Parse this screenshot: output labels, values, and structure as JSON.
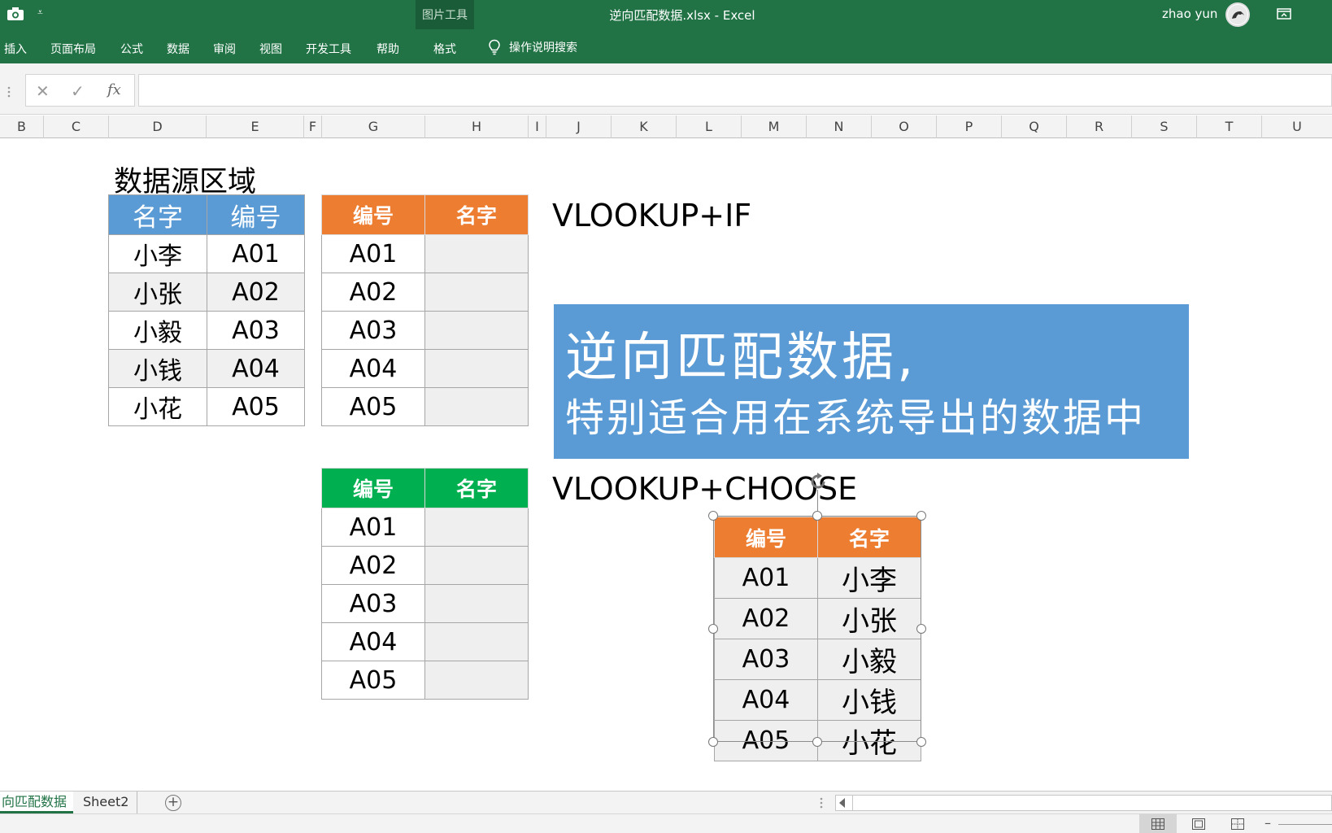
{
  "titlebar": {
    "window_title": "逆向匹配数据.xlsx  -  Excel",
    "context_group": "图片工具",
    "user_name": "zhao yun",
    "qat_more": "⩡"
  },
  "ribbon": {
    "tabs": [
      {
        "label": "插入"
      },
      {
        "label": "页面布局"
      },
      {
        "label": "公式"
      },
      {
        "label": "数据"
      },
      {
        "label": "审阅"
      },
      {
        "label": "视图"
      },
      {
        "label": "开发工具"
      },
      {
        "label": "帮助"
      }
    ],
    "active_tab": "格式",
    "tell_me": "操作说明搜索"
  },
  "formula_bar": {
    "cancel": "✕",
    "enter": "✓",
    "fx": "fx",
    "value": ""
  },
  "columns": [
    "B",
    "C",
    "D",
    "E",
    "F",
    "G",
    "H",
    "I",
    "J",
    "K",
    "L",
    "M",
    "N",
    "O",
    "P",
    "Q",
    "R",
    "S",
    "T",
    "U"
  ],
  "sheet": {
    "source_title": "数据源区域",
    "source_table": {
      "headers": [
        "名字",
        "编号"
      ],
      "rows": [
        [
          "小李",
          "A01"
        ],
        [
          "小张",
          "A02"
        ],
        [
          "小毅",
          "A03"
        ],
        [
          "小钱",
          "A04"
        ],
        [
          "小花",
          "A05"
        ]
      ]
    },
    "if_label": "VLOOKUP+IF",
    "if_table": {
      "headers": [
        "编号",
        "名字"
      ],
      "rows": [
        [
          "A01",
          ""
        ],
        [
          "A02",
          ""
        ],
        [
          "A03",
          ""
        ],
        [
          "A04",
          ""
        ],
        [
          "A05",
          ""
        ]
      ]
    },
    "choose_label": "VLOOKUP+CHOOSE",
    "choose_table": {
      "headers": [
        "编号",
        "名字"
      ],
      "rows": [
        [
          "A01",
          ""
        ],
        [
          "A02",
          ""
        ],
        [
          "A03",
          ""
        ],
        [
          "A04",
          ""
        ],
        [
          "A05",
          ""
        ]
      ]
    },
    "banner": {
      "line1": "逆向匹配数据,",
      "line2": "特别适合用在系统导出的数据中"
    },
    "result_table": {
      "headers": [
        "编号",
        "名字"
      ],
      "rows": [
        [
          "A01",
          "小李"
        ],
        [
          "A02",
          "小张"
        ],
        [
          "A03",
          "小毅"
        ],
        [
          "A04",
          "小钱"
        ],
        [
          "A05",
          "小花"
        ]
      ]
    }
  },
  "sheet_tabs": {
    "active": "向匹配数据",
    "other": "Sheet2",
    "add": "+"
  },
  "statusbar": {
    "zoom_minus": "–"
  },
  "colors": {
    "excel_green": "#217346",
    "header_blue": "#5b9bd5",
    "header_orange": "#ed7d31",
    "header_green": "#00b050"
  }
}
